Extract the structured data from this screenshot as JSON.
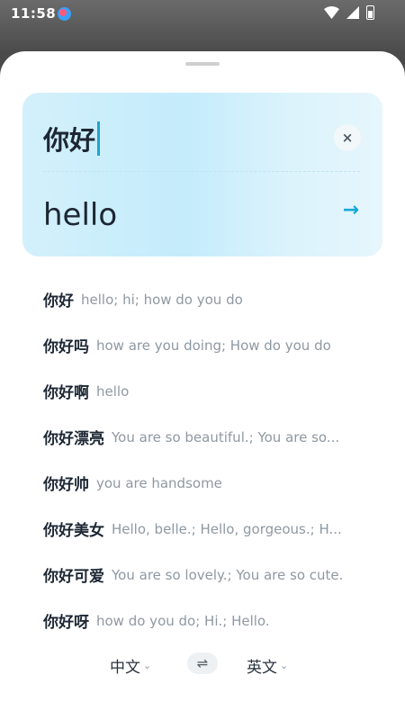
{
  "status": {
    "time": "11:58"
  },
  "translator": {
    "source_text": "你好",
    "target_text": "hello",
    "clear_icon": "×",
    "go_icon": "→"
  },
  "suggestions": [
    {
      "word": "你好",
      "meaning": "hello; hi; how do you do"
    },
    {
      "word": "你好吗",
      "meaning": "how are you doing; How do you do"
    },
    {
      "word": "你好啊",
      "meaning": "hello"
    },
    {
      "word": "你好漂亮",
      "meaning": "You are so beautiful.; You are so..."
    },
    {
      "word": "你好帅",
      "meaning": "you are handsome"
    },
    {
      "word": "你好美女",
      "meaning": "Hello, belle.; Hello, gorgeous.; H..."
    },
    {
      "word": "你好可爱",
      "meaning": "You are so lovely.; You are so cute."
    },
    {
      "word": "你好呀",
      "meaning": "how do you do; Hi.; Hello."
    }
  ],
  "languages": {
    "from": "中文",
    "to": "英文",
    "swap_icon": "⇌",
    "chevron": "⌄"
  }
}
